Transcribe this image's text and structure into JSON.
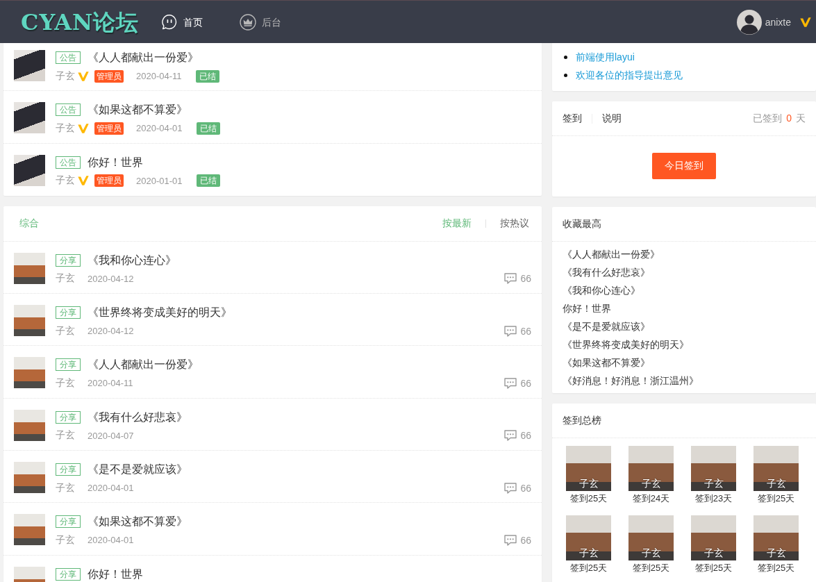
{
  "header": {
    "logo": "CYAN论坛",
    "nav": [
      {
        "label": "首页",
        "selected": true
      },
      {
        "label": "后台",
        "selected": false
      }
    ],
    "user": {
      "name": "anixte",
      "vip": true
    }
  },
  "announcements": [
    {
      "tag": "公告",
      "title": "《人人都献出一份爱》",
      "author": "子玄",
      "vip": true,
      "role": "管理员",
      "date": "2020-04-11",
      "status": "已结"
    },
    {
      "tag": "公告",
      "title": "《如果这都不算爱》",
      "author": "子玄",
      "vip": true,
      "role": "管理员",
      "date": "2020-04-01",
      "status": "已结"
    },
    {
      "tag": "公告",
      "title": "你好！世界",
      "author": "子玄",
      "vip": true,
      "role": "管理员",
      "date": "2020-01-01",
      "status": "已结"
    }
  ],
  "post_list": {
    "tabs": [
      {
        "label": "综合",
        "selected": true
      }
    ],
    "sort": [
      {
        "label": "按最新",
        "selected": true
      },
      {
        "label": "按热议",
        "selected": false
      }
    ],
    "posts": [
      {
        "tag": "分享",
        "title": "《我和你心连心》",
        "author": "子玄",
        "date": "2020-04-12",
        "comments": "66"
      },
      {
        "tag": "分享",
        "title": "《世界终将变成美好的明天》",
        "author": "子玄",
        "date": "2020-04-12",
        "comments": "66"
      },
      {
        "tag": "分享",
        "title": "《人人都献出一份爱》",
        "author": "子玄",
        "date": "2020-04-11",
        "comments": "66"
      },
      {
        "tag": "分享",
        "title": "《我有什么好悲哀》",
        "author": "子玄",
        "date": "2020-04-07",
        "comments": "66"
      },
      {
        "tag": "分享",
        "title": "《是不是爱就应该》",
        "author": "子玄",
        "date": "2020-04-01",
        "comments": "66"
      },
      {
        "tag": "分享",
        "title": "《如果这都不算爱》",
        "author": "子玄",
        "date": "2020-04-01",
        "comments": "66"
      },
      {
        "tag": "分享",
        "title": "你好！世界"
      }
    ]
  },
  "notices": [
    "前端使用layui",
    "欢迎各位的指导提出意见"
  ],
  "sign_in": {
    "tabs": [
      "签到",
      "说明"
    ],
    "status": {
      "prefix": "已签到",
      "count": "0",
      "suffix": "天"
    },
    "button": "今日签到"
  },
  "favorites": {
    "title": "收藏最高",
    "items": [
      "《人人都献出一份爱》",
      "《我有什么好悲哀》",
      "《我和你心连心》",
      "你好！世界",
      "《是不是爱就应该》",
      "《世界终将变成美好的明天》",
      "《如果这都不算爱》",
      "《好消息！好消息！浙江温州》"
    ]
  },
  "leaderboard": {
    "title": "签到总榜",
    "users": [
      {
        "name": "子玄",
        "days": "签到25天"
      },
      {
        "name": "子玄",
        "days": "签到24天"
      },
      {
        "name": "子玄",
        "days": "签到23天"
      },
      {
        "name": "子玄",
        "days": "签到25天"
      },
      {
        "name": "子玄",
        "days": "签到25天"
      },
      {
        "name": "子玄",
        "days": "签到25天"
      },
      {
        "name": "子玄",
        "days": "签到25天"
      },
      {
        "name": "子玄",
        "days": "签到25天"
      }
    ]
  }
}
